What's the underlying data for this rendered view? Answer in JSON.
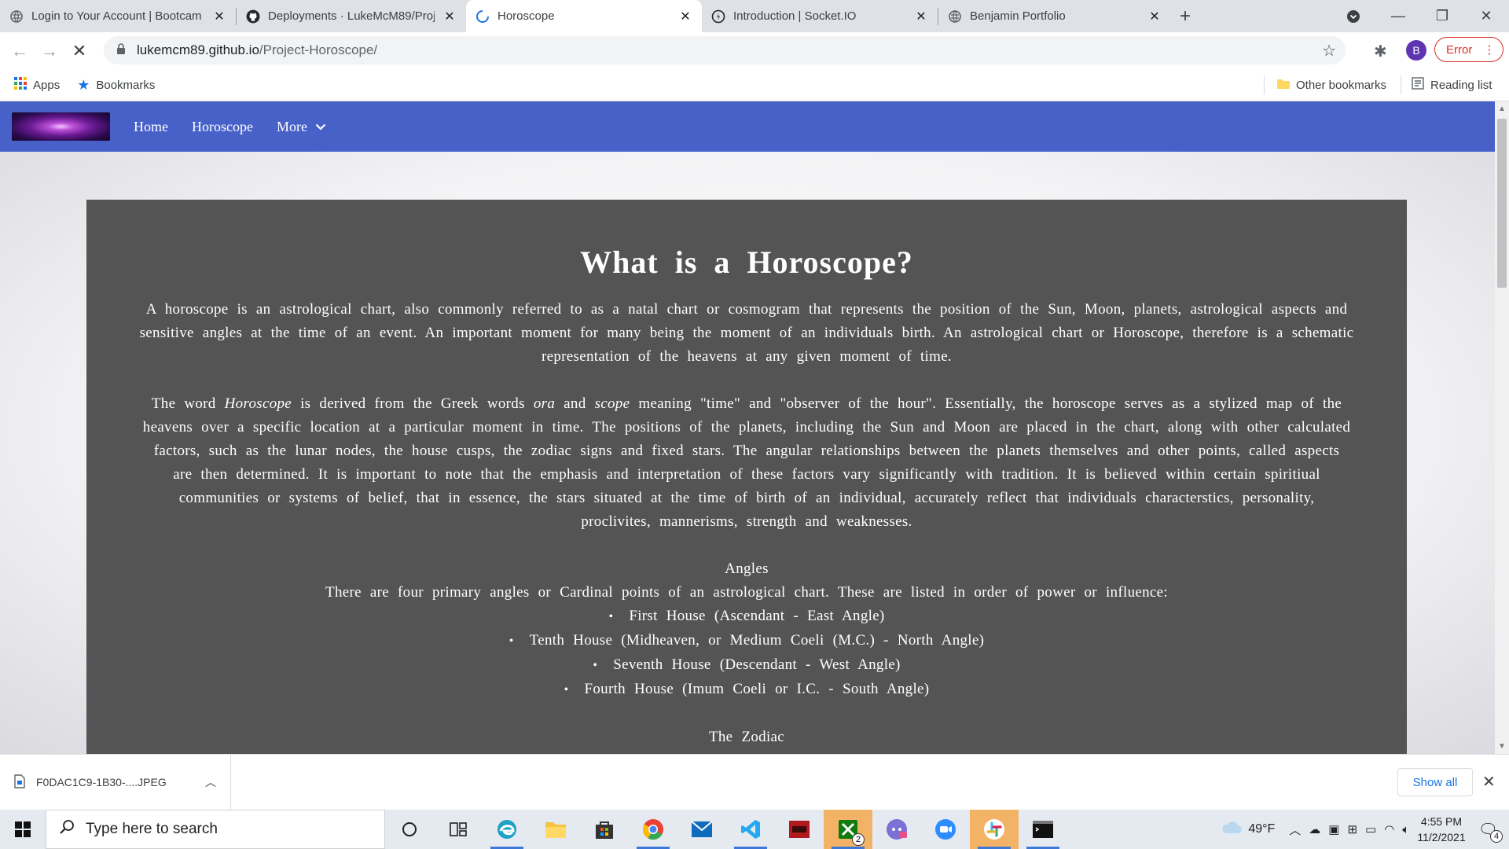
{
  "browser": {
    "tabs": [
      {
        "title": "Login to Your Account | Bootcam",
        "icon": "globe-icon",
        "active": false
      },
      {
        "title": "Deployments · LukeMcM89/Proje",
        "icon": "github-icon",
        "active": false
      },
      {
        "title": "Horoscope",
        "icon": "loading-icon",
        "active": true
      },
      {
        "title": "Introduction | Socket.IO",
        "icon": "socketio-icon",
        "active": false
      },
      {
        "title": "Benjamin Portfolio",
        "icon": "globe-icon",
        "active": false
      }
    ],
    "url_host": "lukemcm89.github.io",
    "url_path": "/Project-Horoscope/",
    "profile_initial": "B",
    "error_label": "Error",
    "bookmarks": {
      "apps": "Apps",
      "bookmarks": "Bookmarks",
      "other": "Other bookmarks",
      "reading_list": "Reading list"
    }
  },
  "site": {
    "nav": {
      "home": "Home",
      "horoscope": "Horoscope",
      "more": "More"
    },
    "heading": "What is a Horoscope?",
    "para1": "A horoscope is an astrological chart, also commonly referred to as a natal chart or cosmogram that represents the position of the Sun, Moon, planets, astrological aspects and sensitive angles at the time of an event. An important moment for many being the moment of an individuals birth. An astrological chart or Horoscope, therefore is a schematic representation of the heavens at any given moment of time.",
    "para2": {
      "t1": "The word ",
      "em1": "Horoscope",
      "t2": " is derived from the Greek words ",
      "em2": "ora",
      "t3": " and ",
      "em3": "scope",
      "t4": " meaning \"time\" and \"observer of the hour\". Essentially, the horoscope serves as a stylized map of the heavens over a specific location at a particular moment in time. The positions of the planets, including the Sun and Moon are placed in the chart, along with other calculated factors, such as the lunar nodes, the house cusps, the zodiac signs and fixed stars. The angular relationships between the planets themselves and other points, called aspects are then determined. It is important to note that the emphasis and interpretation of these factors vary significantly with tradition. It is believed within certain spiritiual communities or systems of belief, that in essence, the stars situated at the time of birth of an individual, accurately reflect that individuals characterstics, personality, proclivites, mannerisms, strength and weaknesses."
    },
    "angles_title": "Angles",
    "angles_intro": "There are four primary angles or Cardinal points of an astrological chart. These are listed in order of power or influence:",
    "angles": [
      "First House (Ascendant - East Angle)",
      "Tenth House (Midheaven, or Medium Coeli (M.C.) - North Angle)",
      "Seventh House (Descendant - West Angle)",
      "Fourth House (Imum Coeli or I.C. - South Angle)"
    ],
    "zodiac_title": "The Zodiac"
  },
  "downloads": {
    "file": "F0DAC1C9-1B30-....JPEG",
    "show_all": "Show all"
  },
  "taskbar": {
    "search_placeholder": "Type here to search",
    "weather": "49°F",
    "time": "4:55 PM",
    "date": "11/2/2021",
    "notifications": "4",
    "xbox_badge": "2",
    "colors": {
      "accent": "#4761c9",
      "card": "#545454"
    }
  }
}
